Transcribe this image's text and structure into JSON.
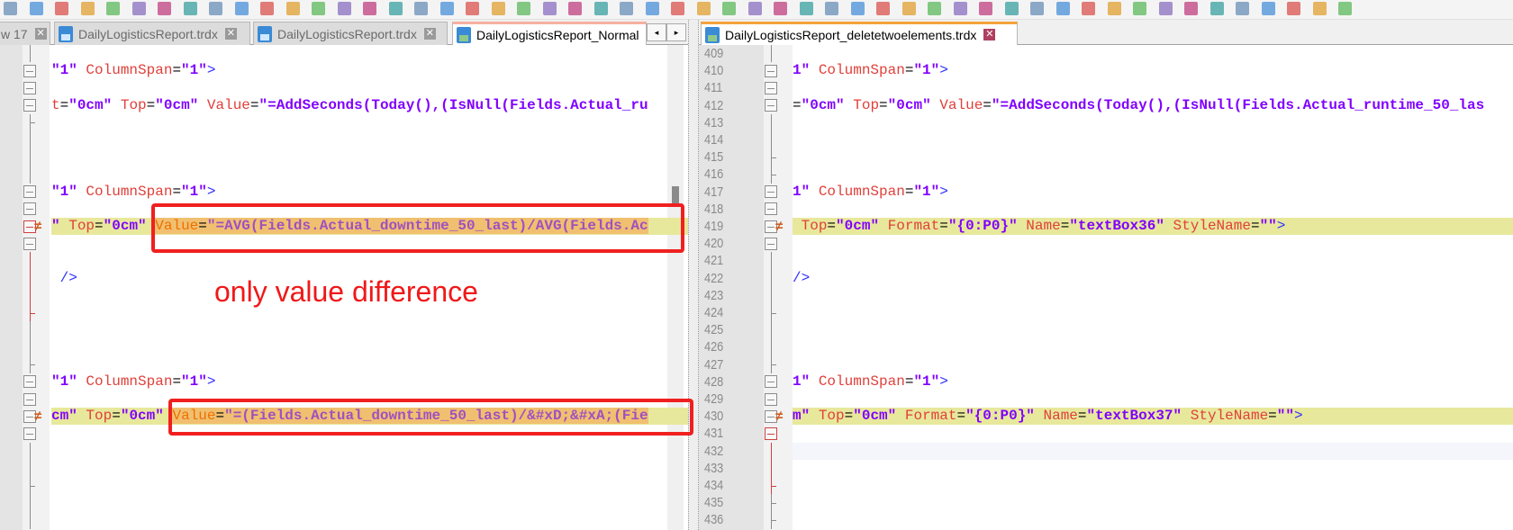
{
  "colors": {
    "accent_annotation": "#f02020",
    "changed_line": "#e8e89c",
    "changed_segment": "#f0c070"
  },
  "toolbar": {
    "icons": [
      "save-all",
      "close",
      "close-all",
      "print",
      "cut",
      "copy",
      "paste",
      "undo",
      "redo",
      "find",
      "replace",
      "zoom-in",
      "zoom-out",
      "sync-v",
      "sync-h",
      "wrap",
      "show-all",
      "indent-guide",
      "udl",
      "doc-map",
      "function-list",
      "folder",
      "monitor",
      "record",
      "stop",
      "play",
      "play-multi",
      "save-macro",
      "compare",
      "clear",
      "first",
      "prev",
      "next",
      "last",
      "diff-only",
      "check",
      "nav",
      "bookmark",
      "a",
      "b",
      "c",
      "d",
      "e",
      "f",
      "g",
      "h",
      "i",
      "j",
      "k",
      "l",
      "m",
      "n",
      "o"
    ]
  },
  "left_tabs": [
    {
      "label": "w 17",
      "active": false
    },
    {
      "label": "DailyLogisticsReport.trdx",
      "active": false
    },
    {
      "label": "DailyLogisticsReport.trdx",
      "active": false
    },
    {
      "label": "DailyLogisticsReport_Normal",
      "active": true
    }
  ],
  "right_tabs": [
    {
      "label": "DailyLogisticsReport_deletetwoelements.trdx",
      "active": true
    }
  ],
  "tab_arrows": {
    "prev": "◂",
    "next": "▸"
  },
  "close_glyph": "✕",
  "annotation": "only value difference",
  "line_numbers": [
    "409",
    "410",
    "411",
    "412",
    "413",
    "414",
    "415",
    "416",
    "417",
    "418",
    "419",
    "420",
    "421",
    "422",
    "423",
    "424",
    "425",
    "426",
    "427",
    "428",
    "429",
    "430",
    "431",
    "432",
    "433",
    "434",
    "435",
    "436"
  ],
  "left_lines": {
    "1": [
      {
        "t": "\"1\"",
        "k": "v"
      },
      {
        "t": " ",
        "k": "e"
      },
      {
        "t": "ColumnSpan",
        "k": "a"
      },
      {
        "t": "=",
        "k": "e"
      },
      {
        "t": "\"1\"",
        "k": "v"
      },
      {
        "t": ">",
        "k": "t"
      }
    ],
    "3": [
      {
        "t": "t",
        "k": "a"
      },
      {
        "t": "=",
        "k": "e"
      },
      {
        "t": "\"0cm\"",
        "k": "v"
      },
      {
        "t": " ",
        "k": "e"
      },
      {
        "t": "Top",
        "k": "a"
      },
      {
        "t": "=",
        "k": "e"
      },
      {
        "t": "\"0cm\"",
        "k": "v"
      },
      {
        "t": " ",
        "k": "e"
      },
      {
        "t": "Value",
        "k": "a"
      },
      {
        "t": "=",
        "k": "e"
      },
      {
        "t": "\"=AddSeconds(Today(),(IsNull(Fields.Actual_ru",
        "k": "v"
      }
    ],
    "8": [
      {
        "t": "\"1\"",
        "k": "v"
      },
      {
        "t": " ",
        "k": "e"
      },
      {
        "t": "ColumnSpan",
        "k": "a"
      },
      {
        "t": "=",
        "k": "e"
      },
      {
        "t": "\"1\"",
        "k": "v"
      },
      {
        "t": ">",
        "k": "t"
      }
    ],
    "10": [
      {
        "t": "\"",
        "k": "v"
      },
      {
        "t": " ",
        "k": "e"
      },
      {
        "t": "Top",
        "k": "a"
      },
      {
        "t": "=",
        "k": "e"
      },
      {
        "t": "\"0cm\"",
        "k": "v"
      },
      {
        "t": " ",
        "k": "e"
      },
      {
        "t": "Value",
        "k": "a",
        "d": true
      },
      {
        "t": "=",
        "k": "e",
        "d": true
      },
      {
        "t": "\"=AVG(Fields.Actual_downtime_50_last)/AVG(Fields.Ac",
        "k": "v",
        "d": true
      }
    ],
    "13": [
      {
        "t": " />",
        "k": "t"
      }
    ],
    "19": [
      {
        "t": "\"1\"",
        "k": "v"
      },
      {
        "t": " ",
        "k": "e"
      },
      {
        "t": "ColumnSpan",
        "k": "a"
      },
      {
        "t": "=",
        "k": "e"
      },
      {
        "t": "\"1\"",
        "k": "v"
      },
      {
        "t": ">",
        "k": "t"
      }
    ],
    "21": [
      {
        "t": "cm\"",
        "k": "v"
      },
      {
        "t": " ",
        "k": "e"
      },
      {
        "t": "Top",
        "k": "a"
      },
      {
        "t": "=",
        "k": "e"
      },
      {
        "t": "\"0cm\"",
        "k": "v"
      },
      {
        "t": " ",
        "k": "e"
      },
      {
        "t": "Value",
        "k": "a",
        "d": true
      },
      {
        "t": "=",
        "k": "e",
        "d": true
      },
      {
        "t": "\"=(Fields.Actual_downtime_50_last)/&#xD;&#xA;(Fie",
        "k": "v",
        "d": true
      }
    ]
  },
  "right_lines": {
    "1": [
      {
        "t": "1\"",
        "k": "v"
      },
      {
        "t": " ",
        "k": "e"
      },
      {
        "t": "ColumnSpan",
        "k": "a"
      },
      {
        "t": "=",
        "k": "e"
      },
      {
        "t": "\"1\"",
        "k": "v"
      },
      {
        "t": ">",
        "k": "t"
      }
    ],
    "3": [
      {
        "t": "=",
        "k": "e"
      },
      {
        "t": "\"0cm\"",
        "k": "v"
      },
      {
        "t": " ",
        "k": "e"
      },
      {
        "t": "Top",
        "k": "a"
      },
      {
        "t": "=",
        "k": "e"
      },
      {
        "t": "\"0cm\"",
        "k": "v"
      },
      {
        "t": " ",
        "k": "e"
      },
      {
        "t": "Value",
        "k": "a"
      },
      {
        "t": "=",
        "k": "e"
      },
      {
        "t": "\"=AddSeconds(Today(),(IsNull(Fields.Actual_runtime_50_las",
        "k": "v"
      }
    ],
    "8": [
      {
        "t": "1\"",
        "k": "v"
      },
      {
        "t": " ",
        "k": "e"
      },
      {
        "t": "ColumnSpan",
        "k": "a"
      },
      {
        "t": "=",
        "k": "e"
      },
      {
        "t": "\"1\"",
        "k": "v"
      },
      {
        "t": ">",
        "k": "t"
      }
    ],
    "10": [
      {
        "t": " ",
        "k": "e"
      },
      {
        "t": "Top",
        "k": "a"
      },
      {
        "t": "=",
        "k": "e"
      },
      {
        "t": "\"0cm\"",
        "k": "v"
      },
      {
        "t": " ",
        "k": "e"
      },
      {
        "t": "Format",
        "k": "a"
      },
      {
        "t": "=",
        "k": "e"
      },
      {
        "t": "\"{0:P0}\"",
        "k": "v"
      },
      {
        "t": " ",
        "k": "e"
      },
      {
        "t": "Name",
        "k": "a"
      },
      {
        "t": "=",
        "k": "e"
      },
      {
        "t": "\"textBox36\"",
        "k": "v"
      },
      {
        "t": " ",
        "k": "e"
      },
      {
        "t": "StyleName",
        "k": "a"
      },
      {
        "t": "=",
        "k": "e"
      },
      {
        "t": "\"\"",
        "k": "v"
      },
      {
        "t": ">",
        "k": "t"
      }
    ],
    "13": [
      {
        "t": "/>",
        "k": "t"
      }
    ],
    "19": [
      {
        "t": "1\"",
        "k": "v"
      },
      {
        "t": " ",
        "k": "e"
      },
      {
        "t": "ColumnSpan",
        "k": "a"
      },
      {
        "t": "=",
        "k": "e"
      },
      {
        "t": "\"1\"",
        "k": "v"
      },
      {
        "t": ">",
        "k": "t"
      }
    ],
    "21": [
      {
        "t": "m\"",
        "k": "v"
      },
      {
        "t": " ",
        "k": "e"
      },
      {
        "t": "Top",
        "k": "a"
      },
      {
        "t": "=",
        "k": "e"
      },
      {
        "t": "\"0cm\"",
        "k": "v"
      },
      {
        "t": " ",
        "k": "e"
      },
      {
        "t": "Format",
        "k": "a"
      },
      {
        "t": "=",
        "k": "e"
      },
      {
        "t": "\"{0:P0}\"",
        "k": "v"
      },
      {
        "t": " ",
        "k": "e"
      },
      {
        "t": "Name",
        "k": "a"
      },
      {
        "t": "=",
        "k": "e"
      },
      {
        "t": "\"textBox37\"",
        "k": "v"
      },
      {
        "t": " ",
        "k": "e"
      },
      {
        "t": "StyleName",
        "k": "a"
      },
      {
        "t": "=",
        "k": "e"
      },
      {
        "t": "\"\"",
        "k": "v"
      },
      {
        "t": ">",
        "k": "t"
      }
    ]
  },
  "changed_rows": [
    "10",
    "21"
  ],
  "current_row_right": "23"
}
